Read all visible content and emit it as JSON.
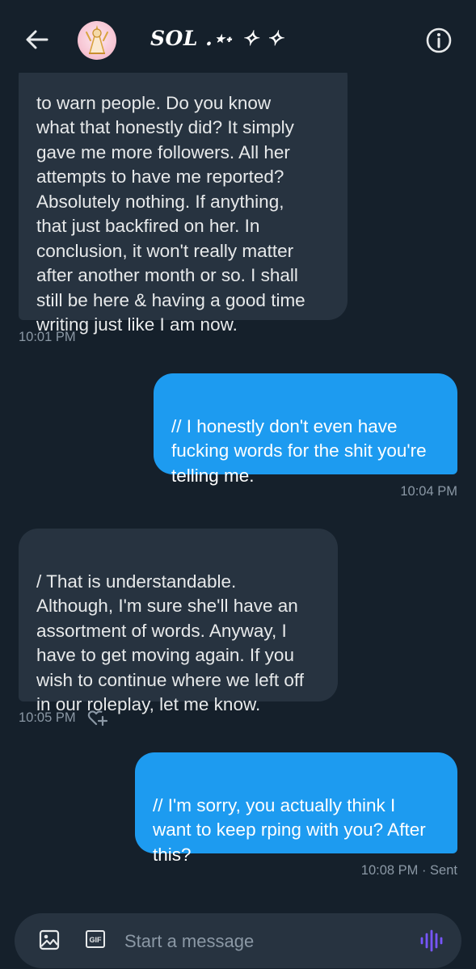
{
  "header": {
    "contact_name": "SOL .⋆˖ ✧ ✧",
    "back_icon": "arrow-left-icon",
    "info_icon": "info-icon"
  },
  "messages": [
    {
      "direction": "incoming",
      "text": "to warn people. Do you know\nwhat that honestly did? It simply\ngave me more followers. All her\nattempts to have me reported?\nAbsolutely nothing. If anything,\nthat just backfired on her. In\nconclusion, it won't really matter\nafter another month or so. I shall\nstill be here & having a good time\nwriting just like I am now.",
      "time": "10:01 PM"
    },
    {
      "direction": "outgoing",
      "text": "// I honestly don't even have\nfucking words for the shit you're\ntelling me.",
      "time": "10:04 PM"
    },
    {
      "direction": "incoming",
      "text": "/ That is understandable.\nAlthough, I'm sure she'll have an\nassortment of words. Anyway, I\nhave to get moving again. If you\nwish to continue where we left off\nin our roleplay, let me know.",
      "time": "10:05 PM",
      "reaction_icon": "add-reaction-icon"
    },
    {
      "direction": "outgoing",
      "text": "// I'm sorry, you actually think I\nwant to keep rping with you? After\nthis?",
      "time": "10:08 PM · Sent"
    }
  ],
  "composer": {
    "placeholder": "Start a message",
    "gif_label": "GIF",
    "image_icon": "image-icon",
    "voice_icon": "voice-message-icon"
  },
  "colors": {
    "background": "#15202b",
    "incoming_bubble": "#273340",
    "outgoing_bubble": "#1d9bf0",
    "timestamp": "#8b98a5",
    "voice_icon": "#7856ff"
  }
}
